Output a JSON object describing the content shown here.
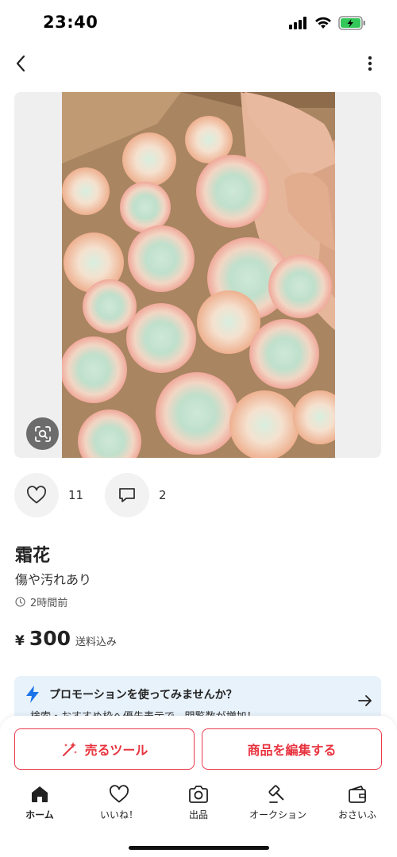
{
  "status_bar": {
    "time": "23:40"
  },
  "product": {
    "title": "霜花",
    "condition": "傷や汚れあり",
    "posted": "2時間前",
    "price_currency": "¥",
    "price": "300",
    "shipping_note": "送料込み"
  },
  "reactions": {
    "likes": "11",
    "comments": "2"
  },
  "promo": {
    "title": "プロモーションを使ってみませんか？",
    "description": "検索・おすすめ枠へ優先表示で、閲覧数が増加！"
  },
  "actions": {
    "sell_tools": "売るツール",
    "edit_item": "商品を編集する"
  },
  "tabs": [
    {
      "label": "ホーム",
      "icon": "home-icon"
    },
    {
      "label": "いいね！",
      "icon": "heart-icon"
    },
    {
      "label": "出品",
      "icon": "camera-icon"
    },
    {
      "label": "オークション",
      "icon": "gavel-icon"
    },
    {
      "label": "おさいふ",
      "icon": "wallet-icon"
    }
  ],
  "colors": {
    "accent": "#ea3a4c",
    "promo_bg": "#e8f2fb",
    "bolt": "#1a73e8"
  }
}
